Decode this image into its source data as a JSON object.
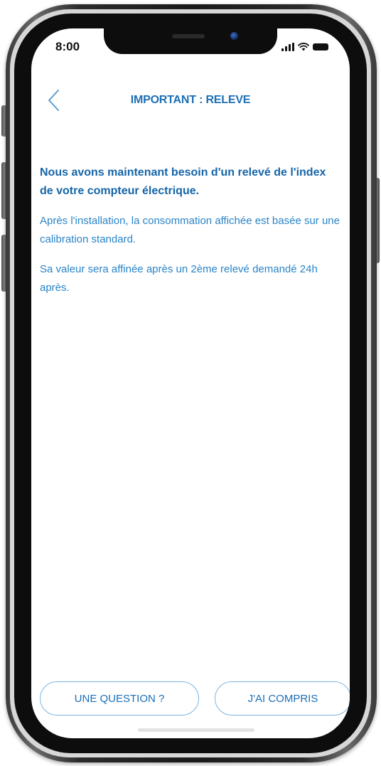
{
  "status_bar": {
    "time": "8:00"
  },
  "header": {
    "title": "IMPORTANT : RELEVE"
  },
  "content": {
    "intro": "Nous avons maintenant besoin d'un relevé de l'index de votre compteur électrique.",
    "paragraph_1": "Après l'installation, la consommation affichée est basée sur une calibration standard.",
    "paragraph_2": "Sa valeur sera affinée après un 2ème relevé demandé 24h après."
  },
  "actions": {
    "question_label": "UNE QUESTION ?",
    "understood_label": "J'AI COMPRIS"
  },
  "theme": {
    "accent": "#1c6fb5",
    "text": "#2a84c7",
    "button_border": "#7fb3de",
    "phone_frame": "#1a1a1a"
  }
}
